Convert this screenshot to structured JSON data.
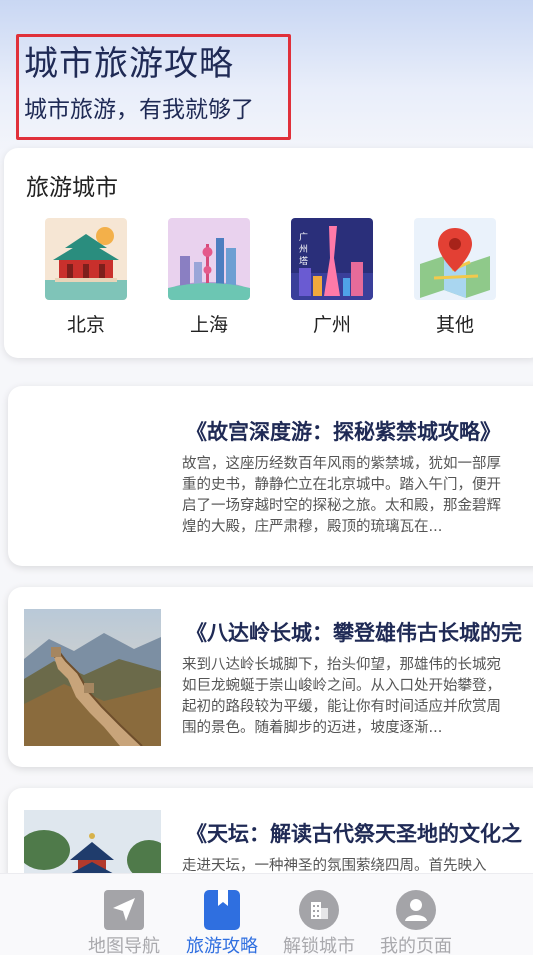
{
  "header": {
    "title": "城市旅游攻略",
    "subtitle": "城市旅游，有我就够了"
  },
  "cities_section": {
    "title": "旅游城市",
    "items": [
      {
        "label": "北京",
        "icon": "beijing-palace-image"
      },
      {
        "label": "上海",
        "icon": "shanghai-skyline-image"
      },
      {
        "label": "广州",
        "icon": "guangzhou-tower-image"
      },
      {
        "label": "其他",
        "icon": "map-pin-image"
      }
    ]
  },
  "articles": [
    {
      "title": "《故宫深度游：探秘紫禁城攻略》",
      "body": "故宫，这座历经数百年风雨的紫禁城，犹如一部厚重的史书，静静伫立在北京城中。踏入午门，便开启了一场穿越时空的探秘之旅。太和殿，那金碧辉煌的大殿，庄严肃穆，殿顶的琉璃瓦在...",
      "image": "none"
    },
    {
      "title": "《八达岭长城：攀登雄伟古长城的完",
      "body": "来到八达岭长城脚下，抬头仰望，那雄伟的长城宛如巨龙蜿蜒于崇山峻岭之间。从入口处开始攀登，起初的路段较为平缓，能让你有时间适应并欣赏周围的景色。随着脚步的迈进，坡度逐渐...",
      "image": "great-wall-image"
    },
    {
      "title": "《天坛：解读古代祭天圣地的文化之",
      "body": "走进天坛，一种神圣的氛围萦绕四周。首先映入",
      "image": "temple-of-heaven-image"
    }
  ],
  "tabbar": {
    "tabs": [
      {
        "label": "地图导航",
        "icon": "navigation-arrow-icon",
        "active": false
      },
      {
        "label": "旅游攻略",
        "icon": "bookmark-book-icon",
        "active": true
      },
      {
        "label": "解锁城市",
        "icon": "building-icon",
        "active": false
      },
      {
        "label": "我的页面",
        "icon": "user-icon",
        "active": false
      }
    ]
  },
  "colors": {
    "accent": "#2f6fe0",
    "title_text": "#1f2a55",
    "inactive_tab": "#a9a9ad",
    "highlight_border": "#e0303a"
  }
}
